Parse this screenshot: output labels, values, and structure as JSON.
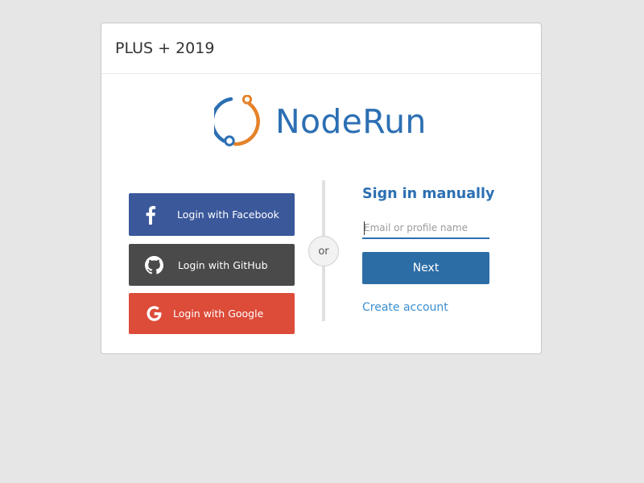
{
  "header": {
    "title": "PLUS + 2019"
  },
  "brand": {
    "name": "NodeRun",
    "colors": {
      "primary": "#2c6fb3",
      "accent": "#e5822a"
    }
  },
  "social": {
    "facebook": {
      "label": "Login with Facebook",
      "icon": "facebook-icon",
      "color": "#3b589b"
    },
    "github": {
      "label": "Login with GitHub",
      "icon": "github-icon",
      "color": "#4a4a4a"
    },
    "google": {
      "label": "Login with Google",
      "icon": "google-icon",
      "color": "#dd4b39"
    }
  },
  "divider": {
    "label": "or"
  },
  "manual": {
    "title": "Sign in manually",
    "email_placeholder": "Email or profile name",
    "email_value": "",
    "next_label": "Next",
    "create_account_label": "Create account"
  }
}
